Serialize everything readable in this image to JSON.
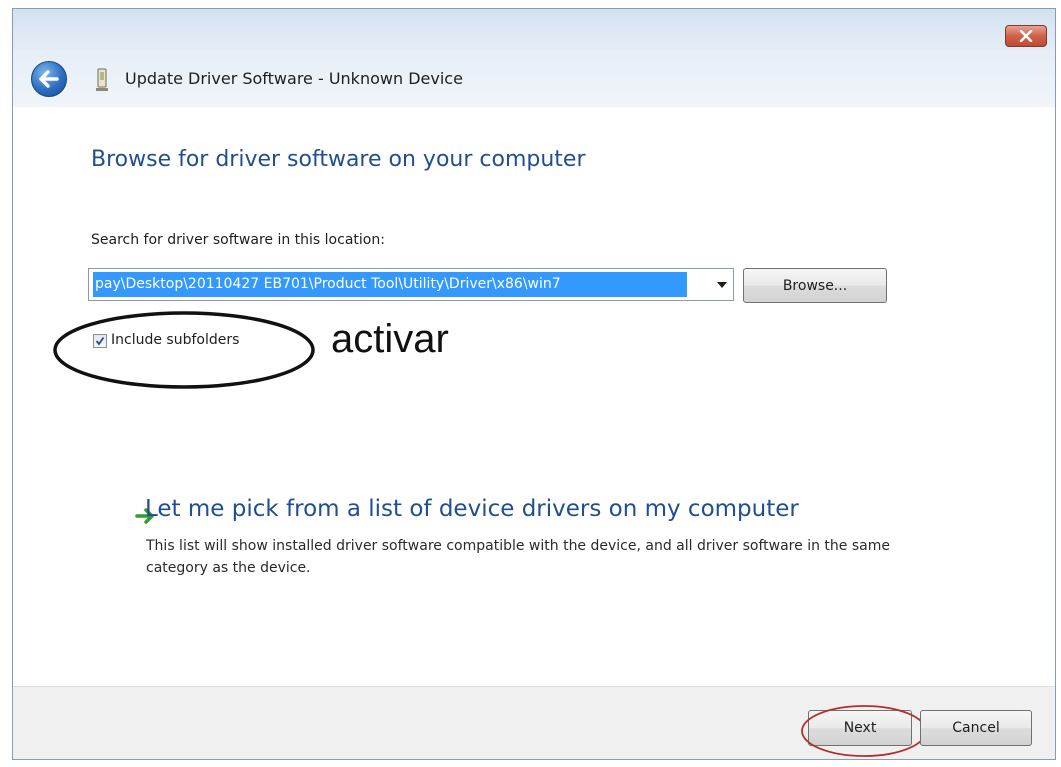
{
  "window": {
    "title": "Update Driver Software - Unknown Device",
    "close_icon": "close-icon",
    "back_icon": "back-arrow-icon",
    "device_icon": "device-icon"
  },
  "main": {
    "heading": "Browse for driver software on your computer",
    "search_label": "Search for driver software in this location:",
    "path_value": "pay\\Desktop\\20110427 EB701\\Product Tool\\Utility\\Driver\\x86\\win7",
    "browse_label": "Browse...",
    "include_subfolders_label": "Include subfolders",
    "include_subfolders_checked": true,
    "annotation": "activar",
    "pick_link_title": "Let me pick from a list of device drivers on my computer",
    "pick_link_desc": "This list will show installed driver software compatible with the device, and all driver software in the same category as the device."
  },
  "footer": {
    "next_label": "Next",
    "cancel_label": "Cancel"
  },
  "colors": {
    "heading": "#1f4f92",
    "selection": "#3399ff",
    "annotation_ellipse": "#111111",
    "next_ellipse": "#b03030",
    "green_arrow": "#2f9e2f"
  }
}
